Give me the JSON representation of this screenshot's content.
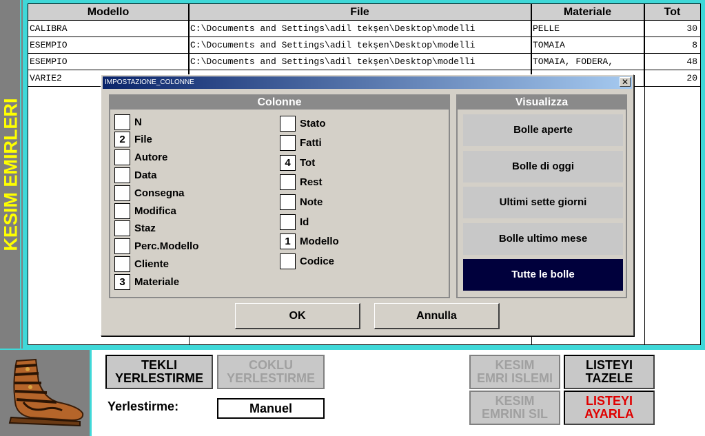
{
  "app": {
    "title": "KESIM EMIRLERI"
  },
  "table": {
    "headers": [
      "Modello",
      "File",
      "Materiale",
      "Tot"
    ],
    "rows": [
      [
        "CALIBRA",
        "C:\\Documents and Settings\\adil tekşen\\Desktop\\modelli",
        "PELLE",
        "30"
      ],
      [
        "ESEMPIO",
        "C:\\Documents and Settings\\adil tekşen\\Desktop\\modelli",
        "TOMAIA",
        "8"
      ],
      [
        "ESEMPIO",
        "C:\\Documents and Settings\\adil tekşen\\Desktop\\modelli",
        "TOMAIA, FODERA,",
        "48"
      ],
      [
        "VARIE2",
        "",
        "",
        "20"
      ]
    ]
  },
  "dialog": {
    "title": "IMPOSTAZIONE_COLONNE",
    "close_label": "✕",
    "columns_header": "Colonne",
    "view_header": "Visualizza",
    "columns_left": [
      {
        "label": "N",
        "order": ""
      },
      {
        "label": "File",
        "order": "2"
      },
      {
        "label": "Autore",
        "order": ""
      },
      {
        "label": "Data",
        "order": ""
      },
      {
        "label": "Consegna",
        "order": ""
      },
      {
        "label": "Modifica",
        "order": ""
      },
      {
        "label": "Staz",
        "order": ""
      },
      {
        "label": "Perc.Modello",
        "order": ""
      },
      {
        "label": "Cliente",
        "order": ""
      },
      {
        "label": "Materiale",
        "order": "3"
      }
    ],
    "columns_right": [
      {
        "label": "Stato",
        "order": ""
      },
      {
        "label": "Fatti",
        "order": ""
      },
      {
        "label": "Tot",
        "order": "4"
      },
      {
        "label": "Rest",
        "order": ""
      },
      {
        "label": "Note",
        "order": ""
      },
      {
        "label": "Id",
        "order": ""
      },
      {
        "label": "Modello",
        "order": "1"
      },
      {
        "label": "Codice",
        "order": ""
      }
    ],
    "view_options": [
      {
        "label": "Bolle aperte",
        "selected": false
      },
      {
        "label": "Bolle di oggi",
        "selected": false
      },
      {
        "label": "Ultimi sette giorni",
        "selected": false
      },
      {
        "label": "Bolle ultimo mese",
        "selected": false
      },
      {
        "label": "Tutte le bolle",
        "selected": true
      }
    ],
    "ok_label": "OK",
    "cancel_label": "Annulla"
  },
  "bottom": {
    "single_placement_label": "TEKLI\nYERLESTIRME",
    "multi_placement_label": "COKLU\nYERLESTIRME",
    "placement_caption": "Yerlestirme:",
    "placement_value": "Manuel",
    "cut_order_process_label": "KESIM\nEMRI ISLEMI",
    "delete_cut_order_label": "KESIM\nEMRINI SIL",
    "refresh_list_label": "LISTEYI\nTAZELE",
    "adjust_list_label": "LISTEYI\nAYARLA"
  },
  "colors": {
    "accent_cyan": "#3fd8d8",
    "title_yellow": "#ffff00",
    "selected_dark": "#00003c",
    "danger_red": "#e00000"
  },
  "icons": {
    "logo": "sandal-icon"
  }
}
